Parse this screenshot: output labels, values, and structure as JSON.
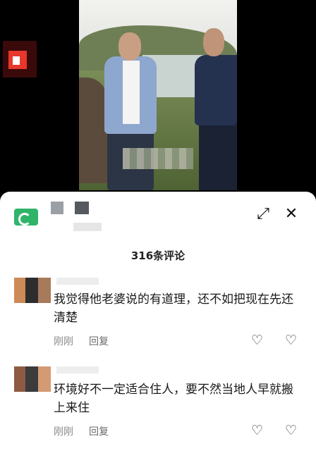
{
  "comments_header": {
    "count_label": "316条评论"
  },
  "comments": [
    {
      "text": "我觉得他老婆说的有道理，还不如把现在先还清楚",
      "time": "刚刚",
      "reply_label": "回复"
    },
    {
      "text": "环境好不一定适合住人，要不然当地人早就搬上来住",
      "time": "刚刚",
      "reply_label": "回复"
    }
  ],
  "icons": {
    "expand": "expand-icon",
    "close": "close-icon",
    "like": "heart-icon",
    "dislike": "broken-heart-icon"
  },
  "colors": {
    "brand_green": "#2fb46a",
    "sheet_bg": "#ffffff"
  }
}
